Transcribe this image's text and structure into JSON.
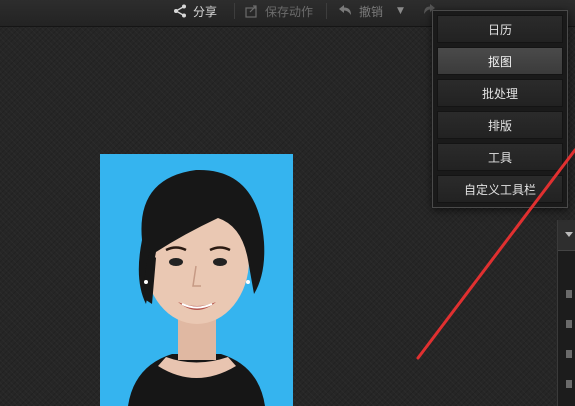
{
  "toolbar": {
    "share_label": "分享",
    "save_action_label": "保存动作",
    "undo_label": "撤销"
  },
  "menu": {
    "items": [
      {
        "label": "日历",
        "active": false
      },
      {
        "label": "抠图",
        "active": true
      },
      {
        "label": "批处理",
        "active": false
      },
      {
        "label": "排版",
        "active": false
      },
      {
        "label": "工具",
        "active": false
      },
      {
        "label": "自定义工具栏",
        "active": false
      }
    ]
  },
  "colors": {
    "photo_background": "#35b4ef",
    "arrow": "#e03030",
    "menu_active": "#444444"
  },
  "icons": {
    "share": "share-icon",
    "save_action": "save-action-icon",
    "undo": "undo-icon",
    "dropdown": "dropdown-arrow-icon",
    "redo": "redo-icon"
  }
}
